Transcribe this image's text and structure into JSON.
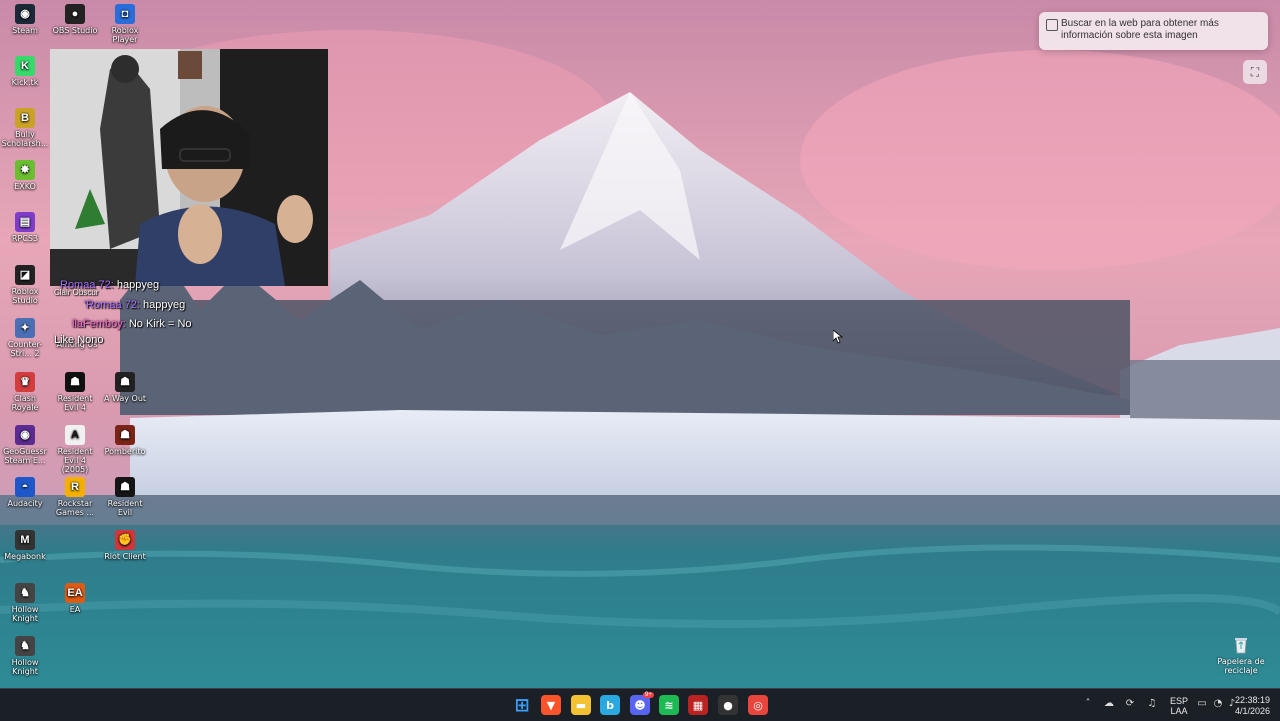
{
  "desktop_icons": [
    {
      "label": "Steam",
      "icon": "steam-icon",
      "color": "#1b2838",
      "glyph": "◉"
    },
    {
      "label": "OBS Studio",
      "icon": "obs-icon",
      "color": "#222222",
      "glyph": "●"
    },
    {
      "label": "Roblox Player",
      "icon": "roblox-icon",
      "color": "#2a6cd8",
      "glyph": "◘"
    },
    {
      "label": "Kick.tk",
      "icon": "kick-icon",
      "color": "#38d96b",
      "glyph": "K"
    },
    {
      "label": "Bully Scholarsh...",
      "icon": "bully-icon",
      "color": "#c9a227",
      "glyph": "B"
    },
    {
      "label": "EXKO",
      "icon": "exko-icon",
      "color": "#6abe30",
      "glyph": "✸"
    },
    {
      "label": "RPCS3",
      "icon": "rpcs3-icon",
      "color": "#7d3cc9",
      "glyph": "▤"
    },
    {
      "label": "Roblox Studio",
      "icon": "roblox-studio-icon",
      "color": "#222222",
      "glyph": "◪"
    },
    {
      "label": "Counter-Stri... 2",
      "icon": "cs2-icon",
      "color": "#4a6fb5",
      "glyph": "✦"
    },
    {
      "label": "Among Us",
      "icon": "among-us-icon",
      "color": "#c22",
      "glyph": "◐"
    },
    {
      "label": "Clash Royale",
      "icon": "clash-royale-icon",
      "color": "#d33d3d",
      "glyph": "♛"
    },
    {
      "label": "Resident Evil 4",
      "icon": "re4-icon",
      "color": "#111111",
      "glyph": "☗"
    },
    {
      "label": "A Way Out",
      "icon": "a-way-out-icon",
      "color": "#222222",
      "glyph": "☗"
    },
    {
      "label": "GeoGuessr Steam E...",
      "icon": "geoguessr-icon",
      "color": "#5b2b91",
      "glyph": "◉"
    },
    {
      "label": "Resident Evil 4 (2005)",
      "icon": "re4-2005-icon",
      "color": "#f1f1f1",
      "glyph": "A"
    },
    {
      "label": "Pomberito",
      "icon": "pomberito-icon",
      "color": "#7a2418",
      "glyph": "☗"
    },
    {
      "label": "Audacity",
      "icon": "audacity-icon",
      "color": "#1e57c9",
      "glyph": "◓"
    },
    {
      "label": "Rockstar Games ...",
      "icon": "rockstar-icon",
      "color": "#f4b000",
      "glyph": "R"
    },
    {
      "label": "Resident Evil",
      "icon": "resident-evil-icon",
      "color": "#151515",
      "glyph": "☗"
    },
    {
      "label": "Megabonk",
      "icon": "megabonk-icon",
      "color": "#333333",
      "glyph": "M"
    },
    {
      "label": "Riot Client",
      "icon": "riot-client-icon",
      "color": "#d13639",
      "glyph": "✊"
    },
    {
      "label": "Hollow Knight",
      "icon": "hollow-knight-icon",
      "color": "#444444",
      "glyph": "♞"
    },
    {
      "label": "EA",
      "icon": "ea-icon",
      "color": "#e05a12",
      "glyph": "EA"
    },
    {
      "label": "Hollow Knight",
      "icon": "hollow-knight-2-icon",
      "color": "#444444",
      "glyph": "♞"
    }
  ],
  "chat": [
    {
      "user": "Romaa 72:",
      "message": "happyeg"
    },
    {
      "user": "'Romaa 72:",
      "message": "happyeg"
    },
    {
      "user": "llaFemboy:",
      "message": "No Kirk = No"
    },
    {
      "user": "",
      "message": "Like Nono"
    }
  ],
  "chat_fragment": "Clair Obscur",
  "lens_tooltip": "Buscar en la web para obtener más información sobre esta imagen",
  "recycle_bin": "Papelera de reciclaje",
  "taskbar": {
    "apps": [
      {
        "name": "start-button",
        "icon": "windows-icon",
        "color": "#3aa0ff",
        "glyph": "⊞"
      },
      {
        "name": "brave-button",
        "icon": "brave-icon",
        "color": "#fb542b",
        "glyph": "▼"
      },
      {
        "name": "file-explorer-button",
        "icon": "folder-icon",
        "color": "#f2c233",
        "glyph": "▬"
      },
      {
        "name": "bing-button",
        "icon": "bing-icon",
        "color": "#2aa8e0",
        "glyph": "b"
      },
      {
        "name": "discord-button",
        "icon": "discord-icon",
        "color": "#5865f2",
        "glyph": "☻"
      },
      {
        "name": "spotify-button",
        "icon": "spotify-icon",
        "color": "#1db954",
        "glyph": "≋"
      },
      {
        "name": "voicemeeter-button",
        "icon": "voicemeeter-icon",
        "color": "#b22",
        "glyph": "▦"
      },
      {
        "name": "obs-taskbar-button",
        "icon": "obs-icon",
        "color": "#333333",
        "glyph": "●"
      },
      {
        "name": "chrome-button",
        "icon": "chrome-icon",
        "color": "#e8453c",
        "glyph": "◎"
      }
    ],
    "discord_badge": "9+",
    "language_line1": "ESP",
    "language_line2": "LAA",
    "time": "22:38:19",
    "date": "4/1/2026"
  }
}
